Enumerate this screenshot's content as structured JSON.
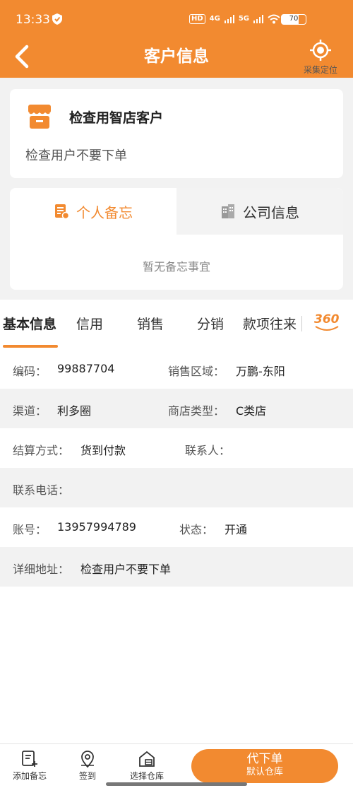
{
  "status": {
    "time": "13:33",
    "battery": "70",
    "net1": "4G",
    "net2": "5G",
    "hd": "HD"
  },
  "header": {
    "title": "客户信息",
    "locate_label": "采集定位"
  },
  "customer": {
    "name": "检查用智店客户",
    "subtitle": "检查用户不要下单"
  },
  "memo_tabs": [
    {
      "label": "个人备忘"
    },
    {
      "label": "公司信息"
    }
  ],
  "memo_empty": "暂无备忘事宜",
  "tabs": [
    "基本信息",
    "信用",
    "销售",
    "分销",
    "款项往来"
  ],
  "icon360_label": "360",
  "info": {
    "code_label": "编码：",
    "code": "99887704",
    "region_label": "销售区域：",
    "region": "万鹏-东阳",
    "channel_label": "渠道：",
    "channel": "利多圈",
    "shop_type_label": "商店类型：",
    "shop_type": "C类店",
    "settle_label": "结算方式：",
    "settle": "货到付款",
    "contact_label": "联系人：",
    "contact": "",
    "phone_label": "联系电话：",
    "phone": "",
    "account_label": "账号：",
    "account": "13957994789",
    "state_label": "状态：",
    "state": "开通",
    "address_label": "详细地址：",
    "address": "检查用户不要下单"
  },
  "bottom": {
    "add_memo": "添加备忘",
    "checkin": "签到",
    "warehouse": "选择仓库",
    "order_main": "代下单",
    "order_sub": "默认仓库"
  },
  "colors": {
    "accent": "#f28a30"
  }
}
